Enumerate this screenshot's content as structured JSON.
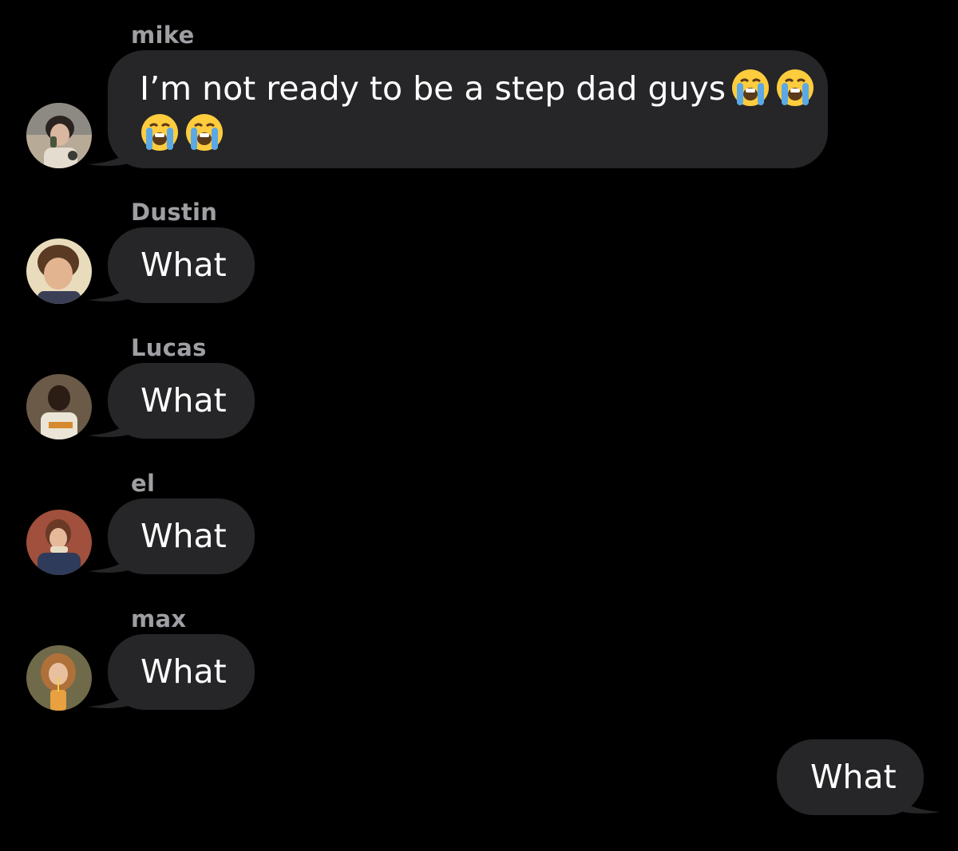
{
  "messages": [
    {
      "sender": "mike",
      "line1": "I’m not ready to be a step dad guys",
      "emoji": "loudly-crying-face-icon",
      "emoji_count_line1": 2,
      "emoji_count_line2": 2
    },
    {
      "sender": "Dustin",
      "text": "What"
    },
    {
      "sender": "Lucas",
      "text": "What"
    },
    {
      "sender": "el",
      "text": "What"
    },
    {
      "sender": "max",
      "text": "What"
    }
  ],
  "outgoing": {
    "text": "What"
  },
  "colors": {
    "background": "#000000",
    "incoming_bubble": "#262628",
    "sender_name": "#9e9ea3",
    "text": "#ffffff"
  }
}
